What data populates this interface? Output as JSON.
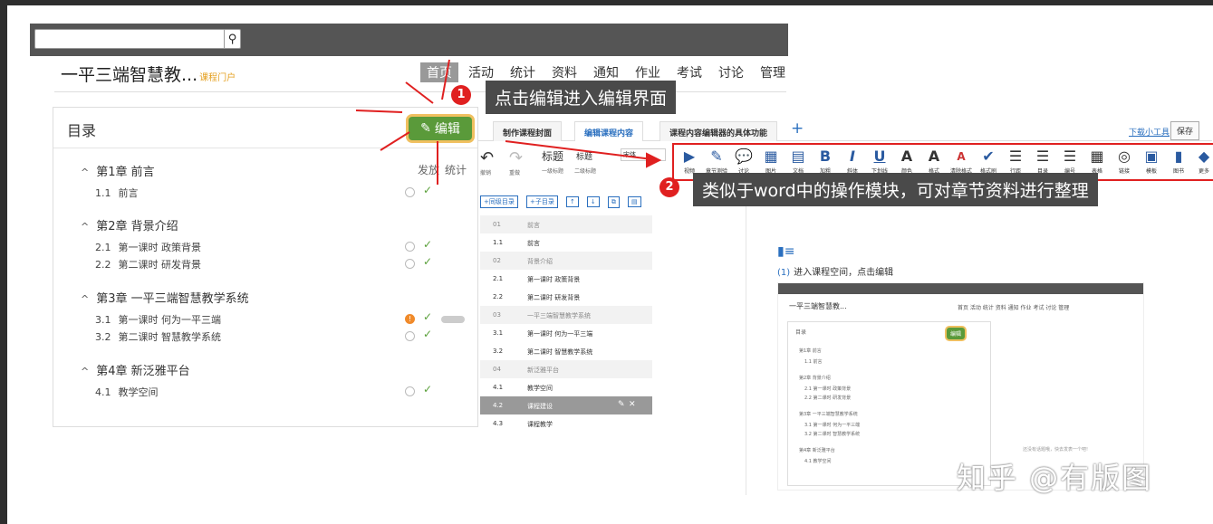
{
  "search": {
    "placeholder": "",
    "icon": "search-icon"
  },
  "course": {
    "title": "一平三端智慧教...",
    "portal": "课程门户"
  },
  "nav": [
    "首页",
    "活动",
    "统计",
    "资料",
    "通知",
    "作业",
    "考试",
    "讨论",
    "管理"
  ],
  "catalog": {
    "heading": "目录",
    "edit_label": "编辑",
    "col_publish": "发放",
    "col_stats": "统计",
    "chapters": [
      {
        "title": "第1章 前言",
        "sections": [
          {
            "num": "1.1",
            "title": "前言"
          }
        ]
      },
      {
        "title": "第2章 背景介绍",
        "sections": [
          {
            "num": "2.1",
            "title": "第一课时 政策背景"
          },
          {
            "num": "2.2",
            "title": "第二课时 研发背景"
          }
        ]
      },
      {
        "title": "第3章 一平三端智慧教学系统",
        "sections": [
          {
            "num": "3.1",
            "title": "第一课时 何为一平三端"
          },
          {
            "num": "3.2",
            "title": "第二课时 智慧教学系统"
          }
        ]
      },
      {
        "title": "第4章 新泛雅平台",
        "sections": [
          {
            "num": "4.1",
            "title": "教学空间"
          }
        ]
      }
    ]
  },
  "annotations": {
    "step1_num": "1",
    "step1_text": "点击编辑进入编辑界面",
    "step2_num": "2",
    "step2_text": "类似于word中的操作模块，可对章节资料进行整理"
  },
  "editor": {
    "tabs": [
      "制作课程封面",
      "编辑课程内容",
      "课程内容编辑器的具体功能"
    ],
    "tab_plus": "+",
    "download_link": "下载小工具",
    "save_label": "保存",
    "undo_label": "撤销",
    "redo_label": "重做",
    "heading_label": "标题",
    "heading_sub": "一级标题",
    "heading2_label": "标题",
    "heading2_sub": "二级标题",
    "font_value": "宋体",
    "toolbar": [
      {
        "icon": "▶",
        "label": "视频"
      },
      {
        "icon": "✎",
        "label": "章节测验"
      },
      {
        "icon": "💬",
        "label": "讨论"
      },
      {
        "icon": "▦",
        "label": "图片"
      },
      {
        "icon": "▤",
        "label": "文档"
      },
      {
        "icon": "B",
        "label": "加粗"
      },
      {
        "icon": "I",
        "label": "斜体"
      },
      {
        "icon": "U",
        "label": "下划线"
      },
      {
        "icon": "A",
        "label": "颜色"
      },
      {
        "icon": "A",
        "label": "格式"
      },
      {
        "icon": "A",
        "label": "清除格式"
      },
      {
        "icon": "✔",
        "label": "格式刷"
      },
      {
        "icon": "☰",
        "label": "行距"
      },
      {
        "icon": "☰",
        "label": "目录"
      },
      {
        "icon": "☰",
        "label": "编号"
      },
      {
        "icon": "▦",
        "label": "表格"
      },
      {
        "icon": "◎",
        "label": "链接"
      },
      {
        "icon": "▣",
        "label": "模板"
      },
      {
        "icon": "▮",
        "label": "图书"
      },
      {
        "icon": "◆",
        "label": "更多"
      }
    ],
    "list_buttons": [
      "+同级目录",
      "+子目录"
    ],
    "list": [
      {
        "num": "01",
        "title": "前言",
        "group": true
      },
      {
        "num": "1.1",
        "title": "前言"
      },
      {
        "num": "02",
        "title": "背景介绍",
        "group": true
      },
      {
        "num": "2.1",
        "title": "第一课时 政策背景"
      },
      {
        "num": "2.2",
        "title": "第二课时 研发背景"
      },
      {
        "num": "03",
        "title": "一平三端智慧教学系统",
        "group": true
      },
      {
        "num": "3.1",
        "title": "第一课时 何为一平三端"
      },
      {
        "num": "3.2",
        "title": "第二课时 智慧教学系统"
      },
      {
        "num": "04",
        "title": "新泛雅平台",
        "group": true
      },
      {
        "num": "4.1",
        "title": "教学空间"
      },
      {
        "num": "4.2",
        "title": "课程建设",
        "selected": true
      },
      {
        "num": "4.3",
        "title": "课程教学"
      }
    ],
    "doc": {
      "step_num": "(1)",
      "step_text": "进入课程空间，点击编辑",
      "thumb_title": "一平三端智慧教...",
      "thumb_nav": "首页 活动 统计 资料 通知 作业 考试 讨论 管理",
      "thumb_catalog": "目录",
      "thumb_edit": "编辑",
      "thumb_lines": [
        "第1章 前言",
        "1.1 前言",
        "第2章 背景介绍",
        "2.1 第一课时 政策背景",
        "2.2 第二课时 研发背景",
        "第3章 一平三端智慧教学系统",
        "3.1 第一课时 何为一平三端",
        "3.2 第二课时 智慧教学系统",
        "第4章 新泛雅平台",
        "4.1 教学空间"
      ],
      "thumb_empty": "还没有话题哦，快去发表一个吧!"
    }
  },
  "watermark": "知乎 @有版图",
  "colors": {
    "edit_green": "#5a9a3a",
    "annotation_red": "#e02020",
    "link_blue": "#2a6fbf"
  }
}
